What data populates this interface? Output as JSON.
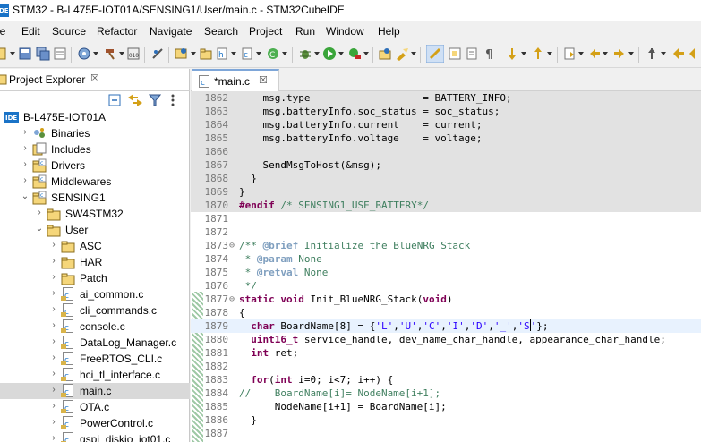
{
  "window": {
    "app_icon_text": "IDE",
    "title": "STM32 - B-L475E-IOT01A/SENSING1/User/main.c - STM32CubeIDE"
  },
  "menu": [
    "le",
    "Edit",
    "Source",
    "Refactor",
    "Navigate",
    "Search",
    "Project",
    "Run",
    "Window",
    "Help"
  ],
  "explorer": {
    "tab_label": "Project Explorer",
    "close_glyph": "☒",
    "project_icon_text": "IDE",
    "items": [
      {
        "label": "B-L475E-IOT01A",
        "depth": 0,
        "expanded": true,
        "icon": "project-icon"
      },
      {
        "label": "Binaries",
        "depth": 1,
        "expanded": false,
        "icon": "binaries-icon"
      },
      {
        "label": "Includes",
        "depth": 1,
        "expanded": false,
        "icon": "includes-icon"
      },
      {
        "label": "Drivers",
        "depth": 1,
        "expanded": false,
        "icon": "source-folder-icon"
      },
      {
        "label": "Middlewares",
        "depth": 1,
        "expanded": false,
        "icon": "source-folder-icon"
      },
      {
        "label": "SENSING1",
        "depth": 1,
        "expanded": true,
        "icon": "source-folder-icon"
      },
      {
        "label": "SW4STM32",
        "depth": 2,
        "expanded": false,
        "icon": "folder-icon"
      },
      {
        "label": "User",
        "depth": 2,
        "expanded": true,
        "icon": "folder-icon"
      },
      {
        "label": "ASC",
        "depth": 3,
        "expanded": false,
        "icon": "folder-icon"
      },
      {
        "label": "HAR",
        "depth": 3,
        "expanded": false,
        "icon": "folder-icon"
      },
      {
        "label": "Patch",
        "depth": 3,
        "expanded": false,
        "icon": "folder-icon"
      },
      {
        "label": "ai_common.c",
        "depth": 3,
        "expanded": false,
        "icon": "c-file-icon"
      },
      {
        "label": "cli_commands.c",
        "depth": 3,
        "expanded": false,
        "icon": "c-file-icon"
      },
      {
        "label": "console.c",
        "depth": 3,
        "expanded": false,
        "icon": "c-file-icon"
      },
      {
        "label": "DataLog_Manager.c",
        "depth": 3,
        "expanded": false,
        "icon": "c-file-icon"
      },
      {
        "label": "FreeRTOS_CLI.c",
        "depth": 3,
        "expanded": false,
        "icon": "c-file-icon"
      },
      {
        "label": "hci_tl_interface.c",
        "depth": 3,
        "expanded": false,
        "icon": "c-file-icon"
      },
      {
        "label": "main.c",
        "depth": 3,
        "expanded": false,
        "icon": "c-file-icon",
        "selected": true
      },
      {
        "label": "OTA.c",
        "depth": 3,
        "expanded": false,
        "icon": "c-file-icon"
      },
      {
        "label": "PowerControl.c",
        "depth": 3,
        "expanded": false,
        "icon": "c-file-icon"
      },
      {
        "label": "qspi_diskio_iot01.c",
        "depth": 3,
        "expanded": false,
        "icon": "c-file-icon"
      }
    ]
  },
  "editor": {
    "tab_label": "*main.c",
    "tab_close_glyph": "☒",
    "lines": [
      {
        "n": "1862",
        "code": "    msg.type                   = BATTERY_INFO;",
        "hl": true
      },
      {
        "n": "1863",
        "code": "    msg.batteryInfo.soc_status = soc_status;",
        "hl": true
      },
      {
        "n": "1864",
        "code": "    msg.batteryInfo.current    = current;",
        "hl": true
      },
      {
        "n": "1865",
        "code": "    msg.batteryInfo.voltage    = voltage;",
        "hl": true
      },
      {
        "n": "1866",
        "code": "",
        "hl": true
      },
      {
        "n": "1867",
        "code": "    SendMsgToHost(&msg);",
        "hl": true
      },
      {
        "n": "1868",
        "code": "  }",
        "hl": true
      },
      {
        "n": "1869",
        "code": "}",
        "hl": true
      },
      {
        "n": "1870",
        "code": "#endif /* SENSING1_USE_BATTERY*/",
        "hl": true
      },
      {
        "n": "1871",
        "code": ""
      },
      {
        "n": "1872",
        "code": ""
      },
      {
        "n": "1873",
        "code": "/** @brief Initialize the BlueNRG Stack",
        "fold": true
      },
      {
        "n": "1874",
        "code": " * @param None"
      },
      {
        "n": "1875",
        "code": " * @retval None"
      },
      {
        "n": "1876",
        "code": " */"
      },
      {
        "n": "1877",
        "code": "static void Init_BlueNRG_Stack(void)",
        "fold": true
      },
      {
        "n": "1878",
        "code": "{"
      },
      {
        "n": "1879",
        "code": "  char BoardName[8] = {'L','U','C','I','D','_','S'};",
        "cur": true
      },
      {
        "n": "1880",
        "code": "  uint16_t service_handle, dev_name_char_handle, appearance_char_handle;"
      },
      {
        "n": "1881",
        "code": "  int ret;"
      },
      {
        "n": "1882",
        "code": ""
      },
      {
        "n": "1883",
        "code": "  for(int i=0; i<7; i++) {"
      },
      {
        "n": "1884",
        "code": "//    BoardName[i]= NodeName[i+1];"
      },
      {
        "n": "1885",
        "code": "      NodeName[i+1] = BoardName[i];"
      },
      {
        "n": "1886",
        "code": "  }"
      },
      {
        "n": "1887",
        "code": ""
      }
    ]
  },
  "colors": {
    "keyword": "#7f0055",
    "comment": "#3f7f5f",
    "string": "#2a00ff",
    "selection": "#d9d9d9",
    "ide_blue": "#1a73c7"
  }
}
